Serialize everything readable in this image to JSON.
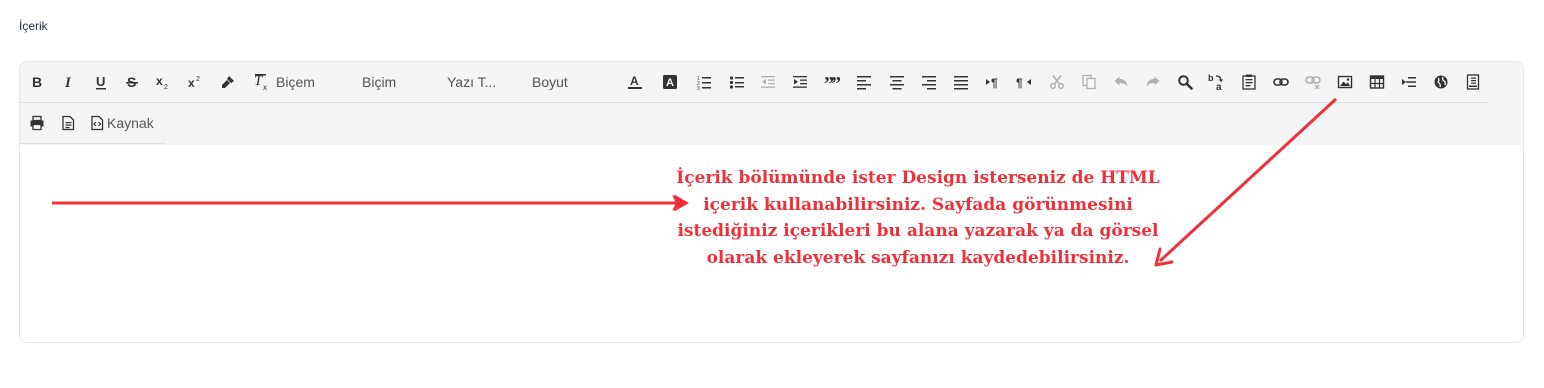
{
  "field": {
    "label": "İçerik"
  },
  "toolbar": {
    "style_combo": "Biçem",
    "format_combo": "Biçim",
    "font_combo": "Yazı T...",
    "size_combo": "Boyut",
    "source_label": "Kaynak",
    "icons": [
      "bold-icon",
      "italic-icon",
      "underline-icon",
      "strikethrough-icon",
      "subscript-icon",
      "superscript-icon",
      "copy-format-icon",
      "remove-format-icon",
      "text-color-icon",
      "background-color-icon",
      "numbered-list-icon",
      "bulleted-list-icon",
      "decrease-indent-icon",
      "increase-indent-icon",
      "blockquote-icon",
      "align-left-icon",
      "align-center-icon",
      "align-right-icon",
      "justify-icon",
      "ltr-icon",
      "rtl-icon",
      "cut-icon",
      "copy-icon",
      "undo-icon",
      "redo-icon",
      "find-icon",
      "replace-icon",
      "paste-text-icon",
      "link-icon",
      "unlink-icon",
      "image-icon",
      "table-icon",
      "insert-indent-icon",
      "iframe-icon",
      "page-break-icon",
      "print-icon",
      "new-page-icon",
      "source-icon"
    ]
  },
  "annotation": {
    "text": "İçerik bölümünde ister Design isterseniz de HTML içerik kullanabilirsiniz. Sayfada görünmesini istediğiniz içerikleri bu alana yazarak ya da görsel olarak ekleyerek sayfanızı kaydedebilirsiniz.",
    "color": "#ee3138"
  }
}
